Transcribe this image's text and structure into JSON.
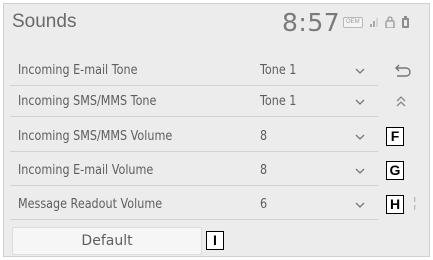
{
  "header": {
    "title": "Sounds",
    "clock": "8:57",
    "status_badge": "OEM",
    "status_icons": [
      "signal-icon",
      "lock-icon",
      "battery-icon"
    ]
  },
  "rows": [
    {
      "label": "Incoming E-mail Tone",
      "value": "Tone 1"
    },
    {
      "label": "Incoming SMS/MMS Tone",
      "value": "Tone 1"
    },
    {
      "label": "Incoming SMS/MMS Volume",
      "value": "8"
    },
    {
      "label": "Incoming E-mail Volume",
      "value": "8"
    },
    {
      "label": "Message Readout Volume",
      "value": "6"
    }
  ],
  "buttons": {
    "default_label": "Default",
    "back_icon": "back-icon",
    "scroll_up_icon": "double-chevron-up-icon"
  },
  "callouts": {
    "f": "F",
    "g": "G",
    "h": "H",
    "i": "I"
  },
  "colors": {
    "screen_bg": "#ececec",
    "text": "#5e5e5e",
    "divider": "#d2d2d2"
  }
}
